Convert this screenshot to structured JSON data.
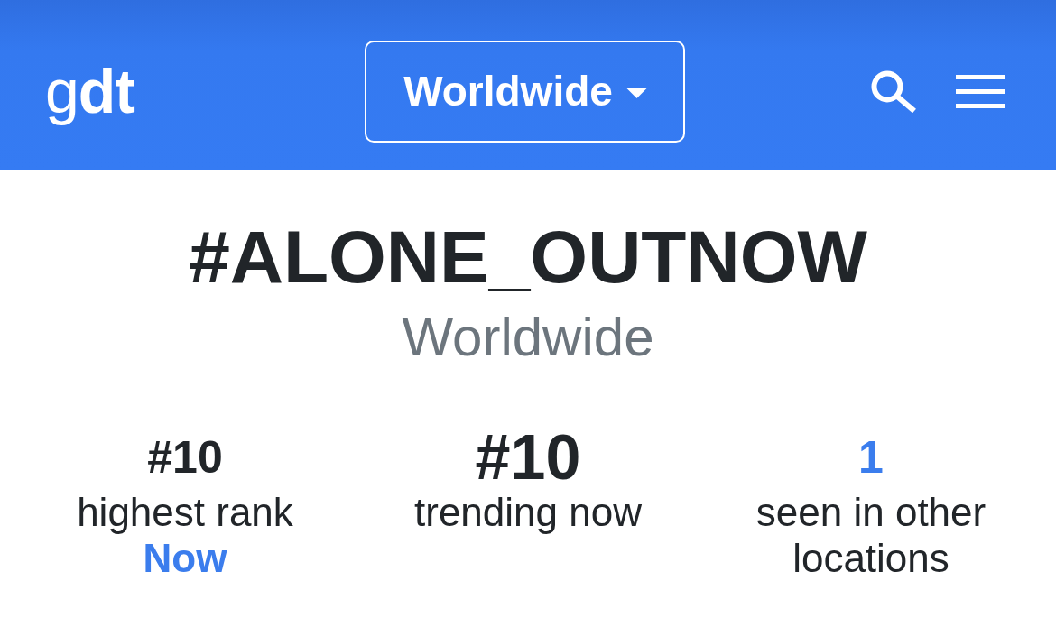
{
  "header": {
    "logo": "g**dt**",
    "location_button": {
      "label": "Worldwide"
    }
  },
  "trend": {
    "title": "#ALONE_OUTNOW",
    "location": "Worldwide"
  },
  "stats": [
    {
      "kind": "rank",
      "value": "#10",
      "label": "highest rank",
      "link": "Now"
    },
    {
      "kind": "current",
      "value": "#10",
      "label": "trending now"
    },
    {
      "kind": "count",
      "value": "1",
      "label": "seen in other locations"
    }
  ]
}
